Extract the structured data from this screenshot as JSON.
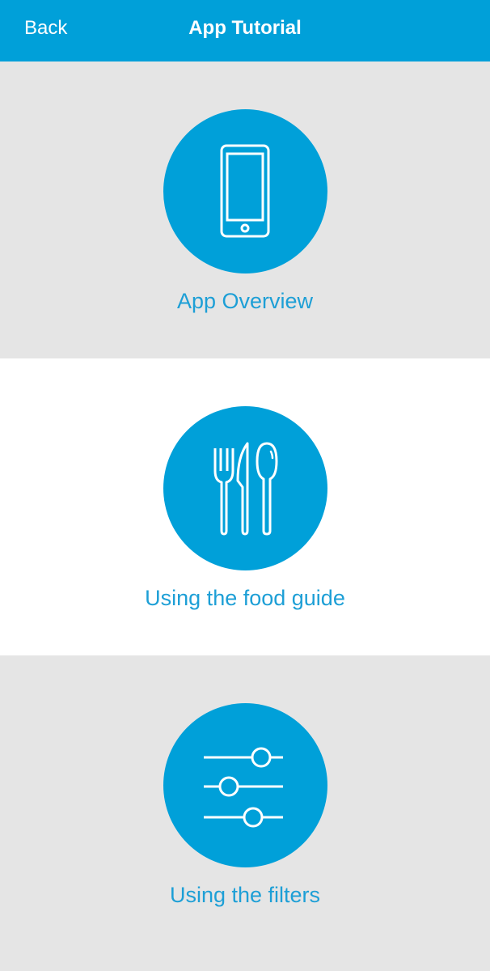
{
  "nav": {
    "back_label": "Back",
    "title": "App Tutorial"
  },
  "sections": [
    {
      "label": "App Overview",
      "icon": "phone-icon"
    },
    {
      "label": "Using the food guide",
      "icon": "cutlery-icon"
    },
    {
      "label": "Using the filters",
      "icon": "sliders-icon"
    }
  ],
  "colors": {
    "accent": "#00a0d9",
    "label": "#1d9fd6",
    "gray_bg": "#e5e5e5",
    "white_bg": "#ffffff"
  }
}
